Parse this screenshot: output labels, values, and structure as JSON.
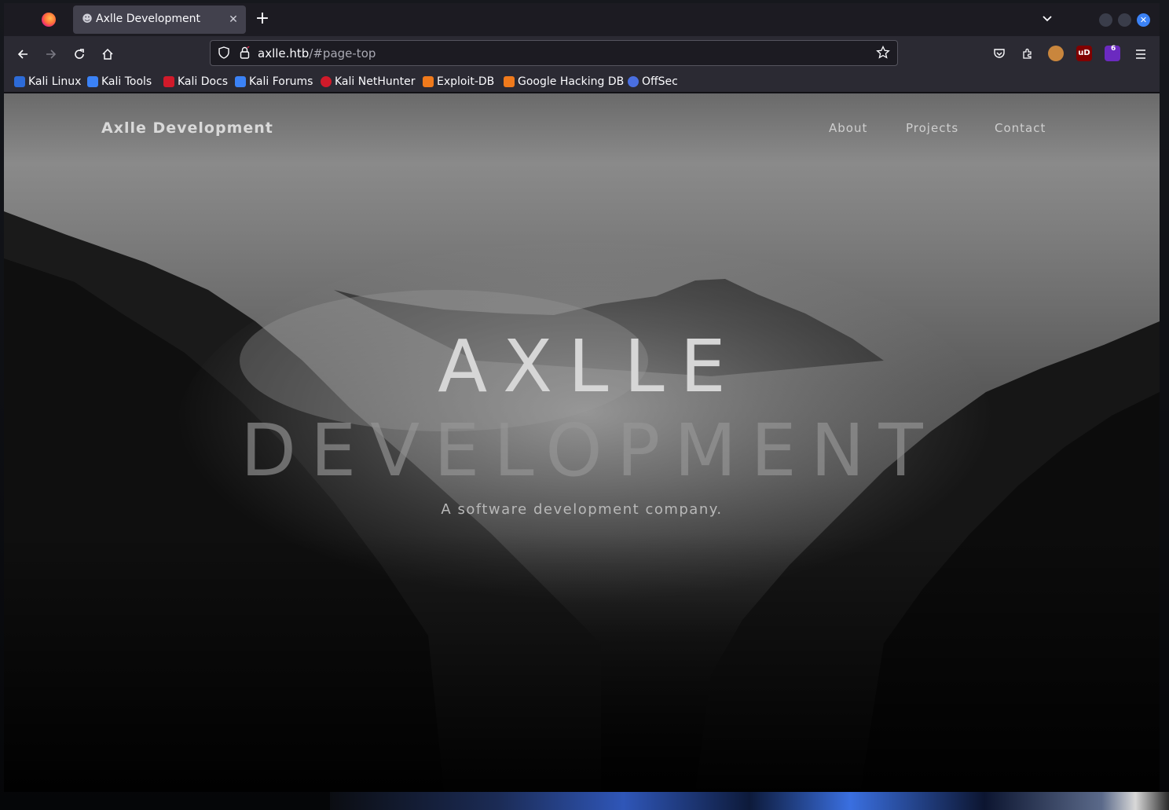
{
  "browser": {
    "tab": {
      "title": "Axlle Development",
      "close_glyph": "✕",
      "icon": "ghost-icon"
    },
    "new_tab_glyph": "+",
    "list_all_glyph": "⌄",
    "url": {
      "host": "axlle.htb",
      "path": "/#page-top"
    },
    "nav": {
      "back": "←",
      "forward": "→",
      "reload": "↻",
      "home": "⌂"
    },
    "bookmarks": [
      {
        "label": "Kali Linux",
        "color": "#2d6bd8"
      },
      {
        "label": "Kali Tools",
        "color": "#3b82f6"
      },
      {
        "label": "Kali Docs",
        "color": "#d11a2a"
      },
      {
        "label": "Kali Forums",
        "color": "#3b82f6"
      },
      {
        "label": "Kali NetHunter",
        "color": "#d11a2a"
      },
      {
        "label": "Exploit-DB",
        "color": "#f07a1c"
      },
      {
        "label": "Google Hacking DB",
        "color": "#f07a1c"
      },
      {
        "label": "OffSec",
        "color": "#4a6fe0"
      }
    ],
    "extensions": {
      "violentmonkey_badge": "6",
      "ublock_label": "uD"
    },
    "accent": "#3b82f6"
  },
  "site": {
    "brand": "Axlle Development",
    "nav": [
      "About",
      "Projects",
      "Contact"
    ],
    "hero_line1": "AXLLE",
    "hero_line2": "DEVELOPMENT",
    "tagline": "A software development company."
  }
}
